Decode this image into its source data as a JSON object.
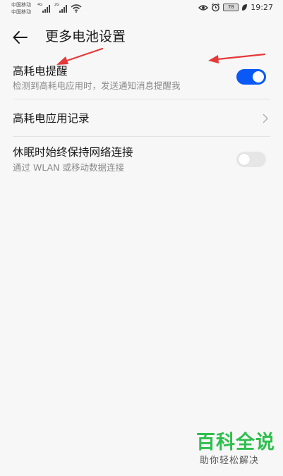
{
  "status_bar": {
    "carrier_1": "中国移动",
    "carrier_2": "中国移动",
    "network_1": "4G",
    "network_2": "2G",
    "battery_level": "78",
    "time": "19:27"
  },
  "app_bar": {
    "title": "更多电池设置"
  },
  "settings": [
    {
      "title": "高耗电提醒",
      "subtitle": "检测到高耗电应用时，发送通知消息提醒我",
      "control": "toggle",
      "enabled": true
    },
    {
      "title": "高耗电应用记录",
      "control": "chevron"
    },
    {
      "title": "休眠时始终保持网络连接",
      "subtitle": "通过 WLAN 或移动数据连接",
      "control": "toggle",
      "enabled": false
    }
  ],
  "watermark": {
    "logo_text": "百科全说",
    "slogan": "助你轻松解决"
  },
  "colors": {
    "accent": "#0a59f7",
    "annotation_arrow": "#e5393a",
    "watermark_green": "#2fbf4e",
    "background": "#f7f7f7"
  },
  "icons": {
    "back": "arrow-left-icon",
    "chevron": "chevron-right-icon",
    "wifi": "wifi-icon",
    "eye": "eye-comfort-icon",
    "alarm": "alarm-icon",
    "battery": "battery-icon",
    "leaf": "power-saving-leaf-icon"
  }
}
